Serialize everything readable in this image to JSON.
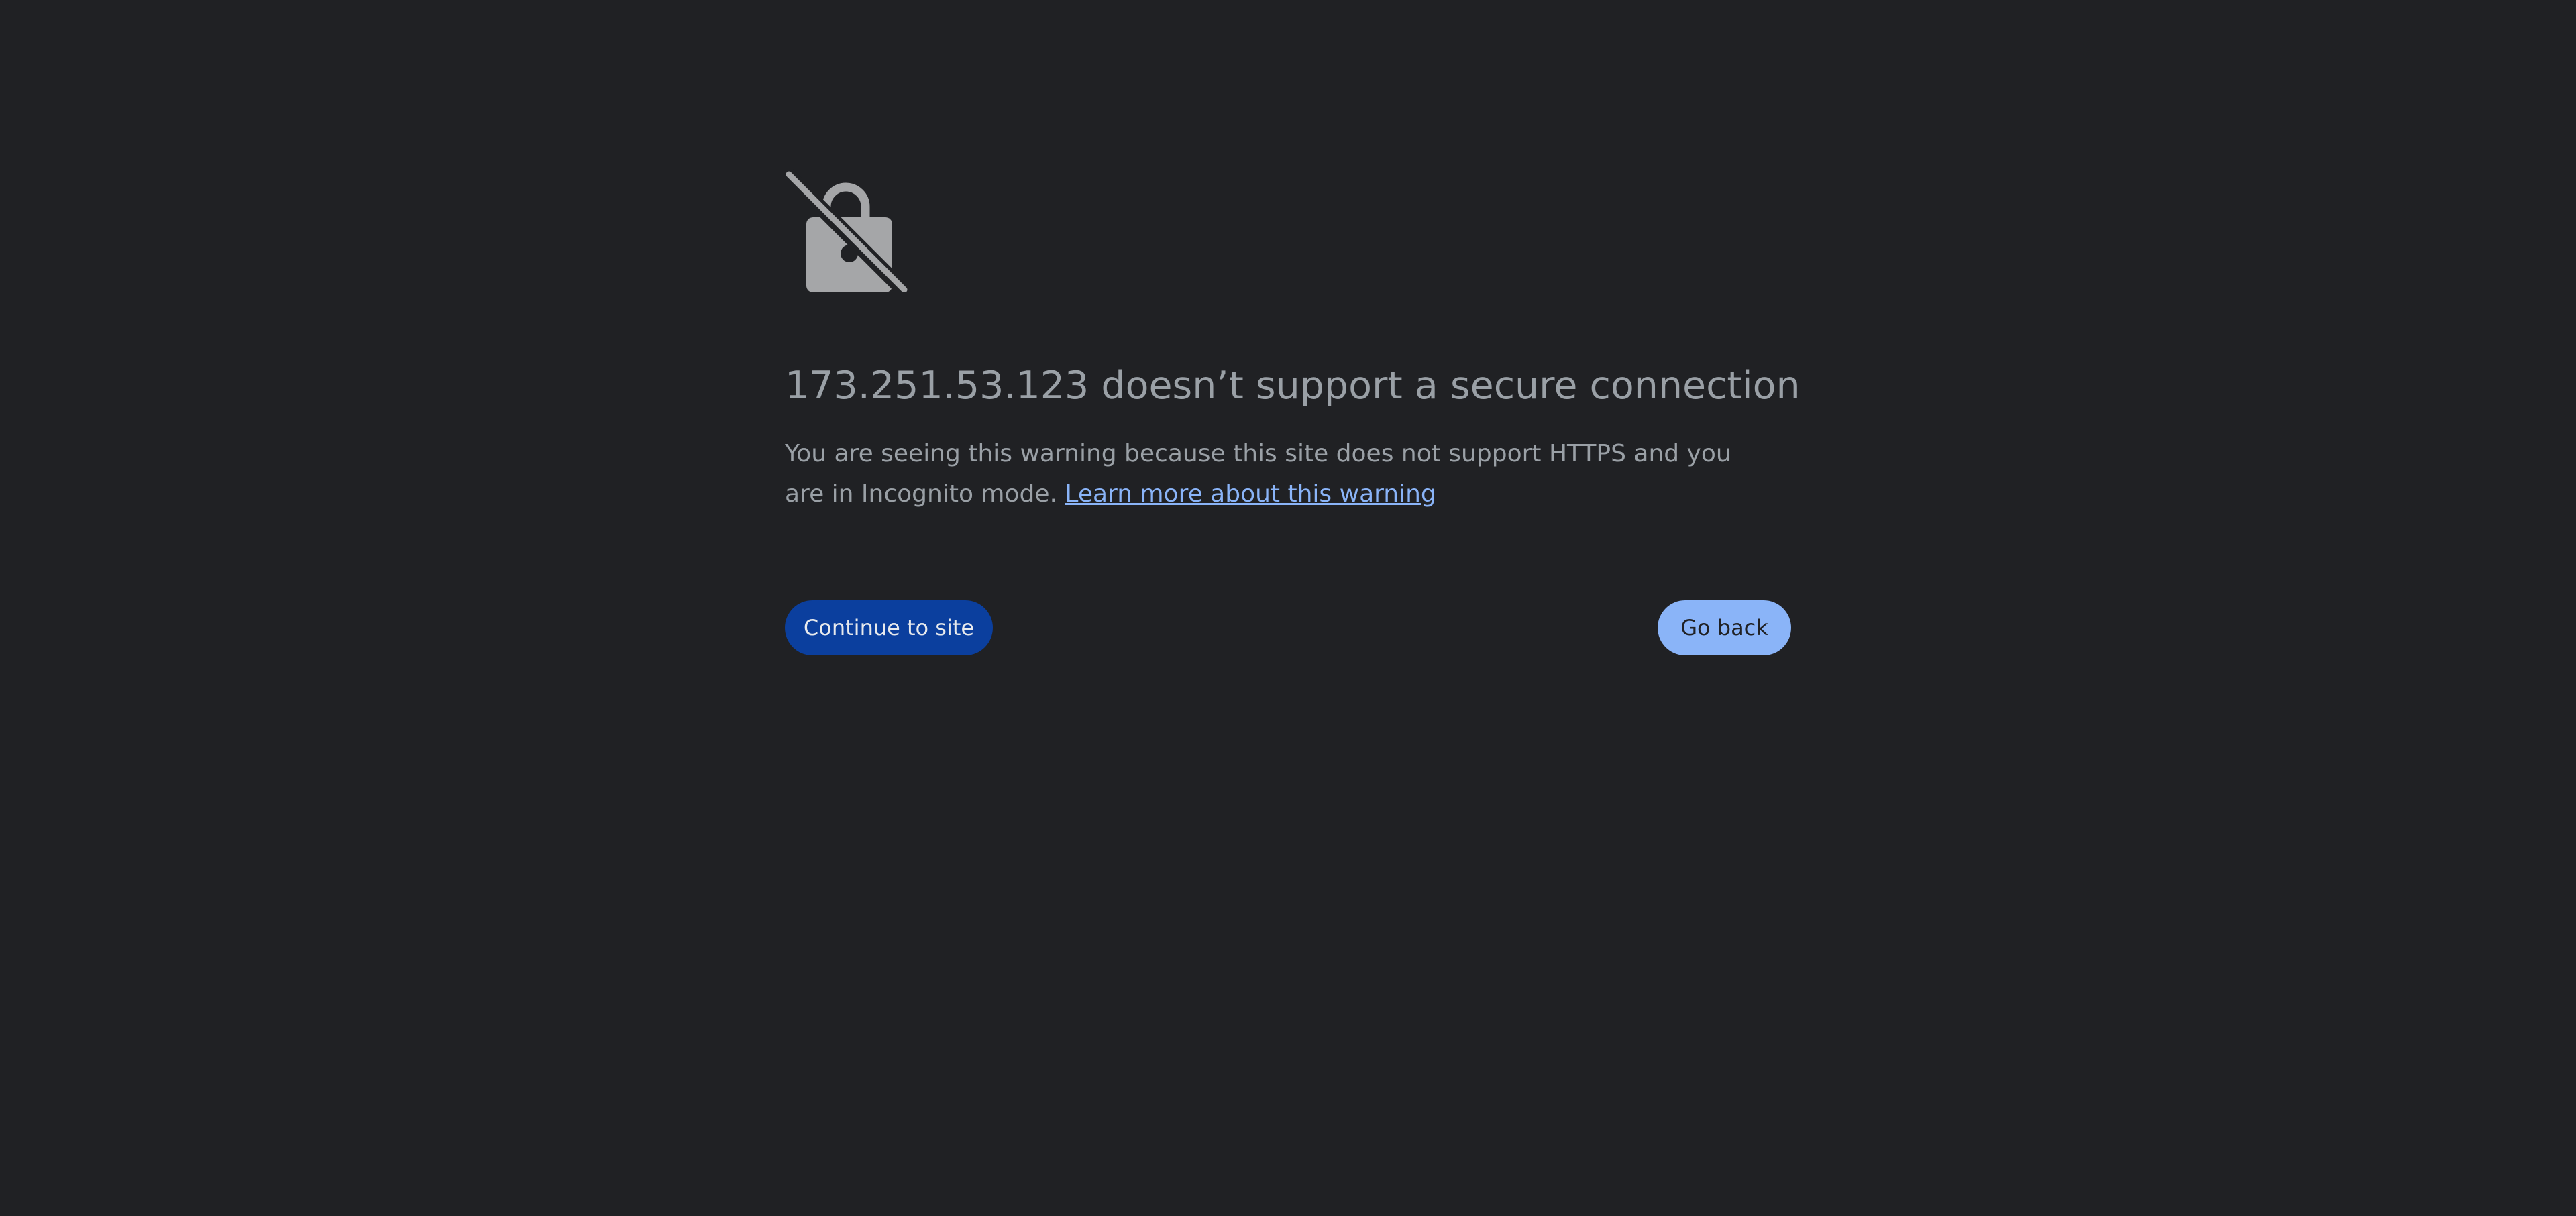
{
  "interstitial": {
    "icon": "lock-off-icon",
    "heading": "173.251.53.123 doesn’t support a secure connection",
    "explanation_text": "You are seeing this warning because this site does not support HTTPS and you are in Incognito mode.",
    "learn_more_link": "Learn more about this warning",
    "continue_button": "Continue to site",
    "back_button": "Go back"
  },
  "colors": {
    "background": "#202124",
    "text": "#9aa0a6",
    "link": "#8ab4f8",
    "primary_button": "#0b3f9e",
    "secondary_button": "#8ab4f8"
  }
}
